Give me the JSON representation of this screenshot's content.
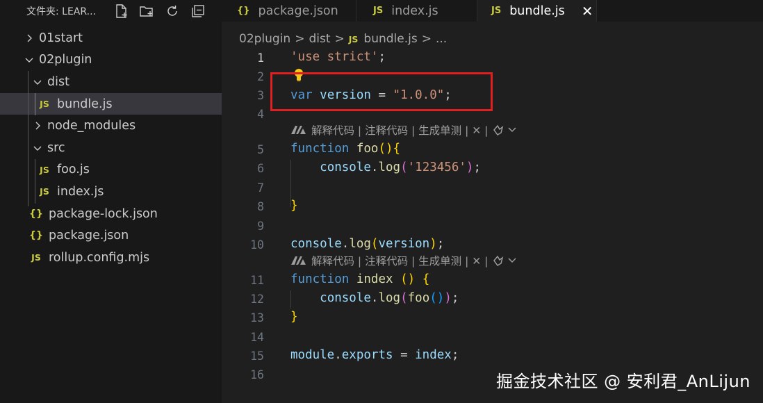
{
  "sidebar": {
    "title": "文件夹: LEAR...",
    "header_icons": [
      "new-file-icon",
      "new-folder-icon",
      "refresh-icon",
      "collapse-all-icon"
    ],
    "items": [
      {
        "label": "01start",
        "type": "folder",
        "expanded": false
      },
      {
        "label": "02plugin",
        "type": "folder",
        "expanded": true
      },
      {
        "label": "dist",
        "type": "folder",
        "expanded": true
      },
      {
        "label": "bundle.js",
        "type": "js",
        "icon": "JS",
        "selected": true
      },
      {
        "label": "node_modules",
        "type": "folder",
        "expanded": false
      },
      {
        "label": "src",
        "type": "folder",
        "expanded": true
      },
      {
        "label": "foo.js",
        "type": "js",
        "icon": "JS"
      },
      {
        "label": "index.js",
        "type": "js",
        "icon": "JS"
      },
      {
        "label": "package-lock.json",
        "type": "json",
        "icon": "{}"
      },
      {
        "label": "package.json",
        "type": "json",
        "icon": "{}"
      },
      {
        "label": "rollup.config.mjs",
        "type": "js",
        "icon": "JS"
      }
    ]
  },
  "tabs": [
    {
      "label": "package.json",
      "icon": "{}",
      "active": false
    },
    {
      "label": "index.js",
      "icon": "JS",
      "active": false
    },
    {
      "label": "bundle.js",
      "icon": "JS",
      "active": true,
      "close": "✕"
    }
  ],
  "breadcrumb": {
    "folder": "02plugin",
    "subfolder": "dist",
    "file_icon": "JS",
    "file": "bundle.js",
    "more": "...",
    "sep": ">"
  },
  "editor": {
    "current_line": 1,
    "code_lens": {
      "text": "解释代码 | 注释代码 | 生成单测 | ✕ |"
    },
    "line_numbers": [
      "1",
      "2",
      "3",
      "4",
      "5",
      "6",
      "7",
      "8",
      "9",
      "10",
      "11",
      "12",
      "13",
      "14",
      "15",
      "16"
    ]
  },
  "watermark": "掘金技术社区 @ 安利君_AnLijun",
  "colors": {
    "keyword": "#569cd6",
    "function": "#dcdcaa",
    "string": "#ce9178",
    "variable": "#9cdcfe",
    "highlight_box": "#e02020",
    "js_icon": "#cbcb41"
  }
}
